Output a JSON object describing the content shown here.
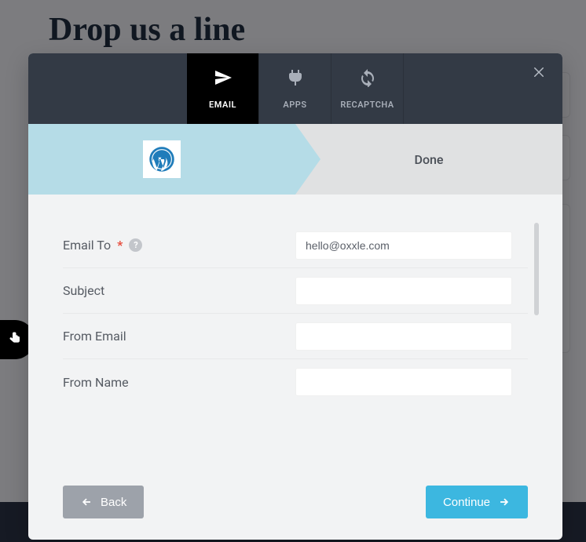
{
  "page": {
    "title": "Drop us a line"
  },
  "modal": {
    "tabs": {
      "email": "EMAIL",
      "apps": "APPS",
      "recaptcha": "RECAPTCHA"
    },
    "steps": {
      "done": "Done"
    },
    "form": {
      "email_to": {
        "label": "Email To",
        "value": "hello@oxxle.com",
        "required": true
      },
      "subject": {
        "label": "Subject",
        "value": ""
      },
      "from_email": {
        "label": "From Email",
        "value": ""
      },
      "from_name": {
        "label": "From Name",
        "value": ""
      }
    },
    "actions": {
      "back": "Back",
      "continue": "Continue"
    },
    "help_tooltip": "?"
  },
  "colors": {
    "accent": "#3cb7e0",
    "header": "#333a45",
    "step_active": "#b5dce7",
    "step_inactive": "#e0e1e2"
  }
}
